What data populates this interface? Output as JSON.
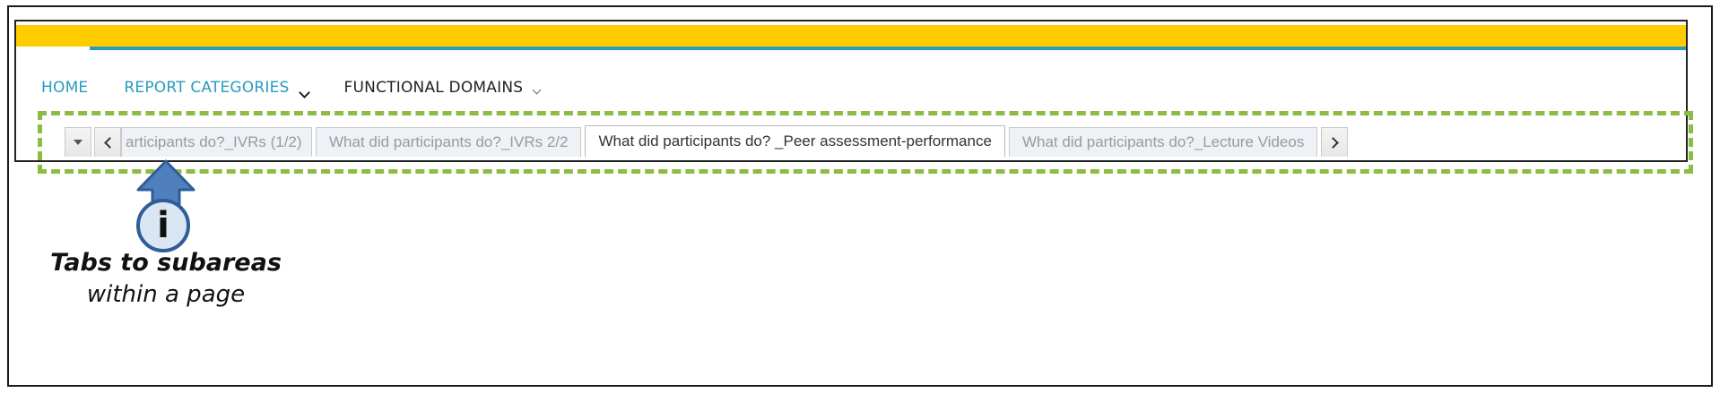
{
  "nav": {
    "items": [
      {
        "label": "HOME"
      },
      {
        "label": "REPORT CATEGORIES"
      },
      {
        "label": "FUNCTIONAL DOMAINS"
      }
    ]
  },
  "tabs": {
    "items": [
      {
        "label": "articipants do?_IVRs (1/2)",
        "active": false
      },
      {
        "label": "What did participants do?_IVRs 2/2",
        "active": false
      },
      {
        "label": "What did participants do? _Peer assessment-performance",
        "active": true
      },
      {
        "label": "What did participants do?_Lecture Videos",
        "active": false
      }
    ]
  },
  "annotation": {
    "icon_glyph": "i",
    "title": "Tabs to subareas",
    "subtitle": "within a page"
  },
  "colors": {
    "brand_yellow": "#ffcc00",
    "accent_blue": "#2a9bc0",
    "highlight_green": "#8cbd43",
    "callout_blue": "#4f7fbc"
  },
  "icons": {
    "tab_menu": "caret-down-icon",
    "scroll_left": "chevron-left-icon",
    "scroll_right": "chevron-right-icon",
    "nav_dropdown": "chevron-down-icon",
    "callout": "info-icon"
  }
}
